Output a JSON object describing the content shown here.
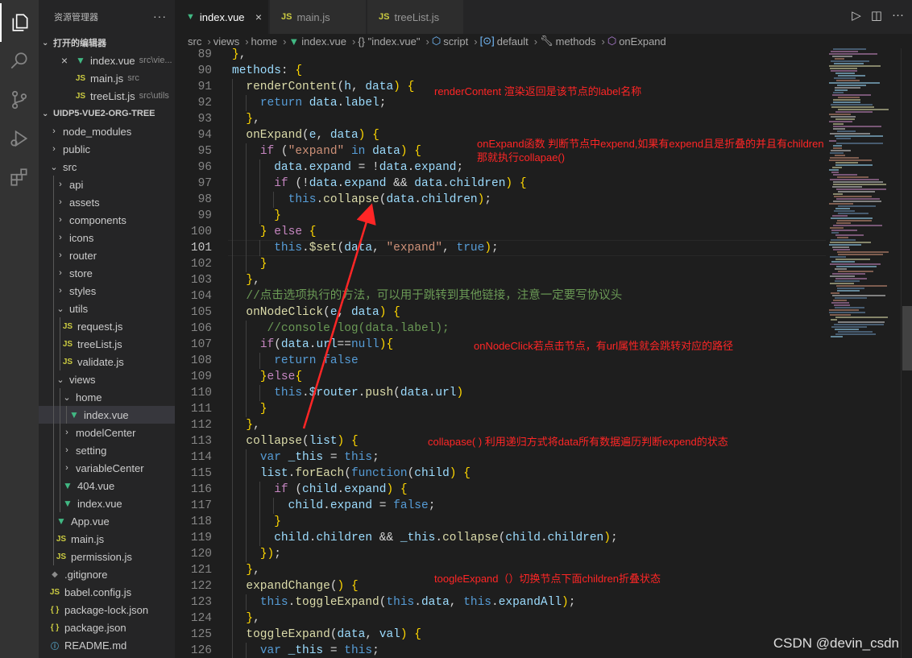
{
  "sidebar": {
    "title": "资源管理器",
    "more": "···",
    "open_editors_label": "打开的编辑器",
    "open_editors": [
      {
        "name": "index.vue",
        "desc": "src\\vie...",
        "type": "vue",
        "close": "×"
      },
      {
        "name": "main.js",
        "desc": "src",
        "type": "js"
      },
      {
        "name": "treeList.js",
        "desc": "src\\utils",
        "type": "js"
      }
    ],
    "project_label": "UIDP5-VUE2-ORG-TREE",
    "tree": [
      {
        "name": "node_modules",
        "kind": "folder",
        "open": false,
        "depth": 0
      },
      {
        "name": "public",
        "kind": "folder",
        "open": false,
        "depth": 0
      },
      {
        "name": "src",
        "kind": "folder",
        "open": true,
        "depth": 0
      },
      {
        "name": "api",
        "kind": "folder",
        "open": false,
        "depth": 1
      },
      {
        "name": "assets",
        "kind": "folder",
        "open": false,
        "depth": 1
      },
      {
        "name": "components",
        "kind": "folder",
        "open": false,
        "depth": 1
      },
      {
        "name": "icons",
        "kind": "folder",
        "open": false,
        "depth": 1
      },
      {
        "name": "router",
        "kind": "folder",
        "open": false,
        "depth": 1
      },
      {
        "name": "store",
        "kind": "folder",
        "open": false,
        "depth": 1
      },
      {
        "name": "styles",
        "kind": "folder",
        "open": false,
        "depth": 1
      },
      {
        "name": "utils",
        "kind": "folder",
        "open": true,
        "depth": 1
      },
      {
        "name": "request.js",
        "kind": "js",
        "depth": 2
      },
      {
        "name": "treeList.js",
        "kind": "js",
        "depth": 2
      },
      {
        "name": "validate.js",
        "kind": "js",
        "depth": 2
      },
      {
        "name": "views",
        "kind": "folder",
        "open": true,
        "depth": 1
      },
      {
        "name": "home",
        "kind": "folder",
        "open": true,
        "depth": 2
      },
      {
        "name": "index.vue",
        "kind": "vue",
        "depth": 3,
        "selected": true
      },
      {
        "name": "modelCenter",
        "kind": "folder",
        "open": false,
        "depth": 2
      },
      {
        "name": "setting",
        "kind": "folder",
        "open": false,
        "depth": 2
      },
      {
        "name": "variableCenter",
        "kind": "folder",
        "open": false,
        "depth": 2
      },
      {
        "name": "404.vue",
        "kind": "vue",
        "depth": 2
      },
      {
        "name": "index.vue",
        "kind": "vue",
        "depth": 2
      },
      {
        "name": "App.vue",
        "kind": "vue",
        "depth": 1
      },
      {
        "name": "main.js",
        "kind": "js",
        "depth": 1
      },
      {
        "name": "permission.js",
        "kind": "js",
        "depth": 1
      },
      {
        "name": ".gitignore",
        "kind": "git",
        "depth": 0
      },
      {
        "name": "babel.config.js",
        "kind": "js",
        "depth": 0
      },
      {
        "name": "package-lock.json",
        "kind": "json",
        "depth": 0
      },
      {
        "name": "package.json",
        "kind": "json",
        "depth": 0
      },
      {
        "name": "README.md",
        "kind": "md",
        "depth": 0
      }
    ]
  },
  "tabs": [
    {
      "label": "index.vue",
      "type": "vue",
      "active": true,
      "close": "×"
    },
    {
      "label": "main.js",
      "type": "js",
      "active": false
    },
    {
      "label": "treeList.js",
      "type": "js",
      "active": false
    }
  ],
  "breadcrumb": {
    "parts": [
      "src",
      "views",
      "home",
      "index.vue",
      "{} \"index.vue\"",
      "script",
      "default",
      "methods",
      "onExpand"
    ]
  },
  "editor": {
    "current_line": 101,
    "lines": [
      {
        "n": 89,
        "code": "},"
      },
      {
        "n": 90,
        "code": "methods: {"
      },
      {
        "n": 91,
        "code": "  renderContent(h, data) {"
      },
      {
        "n": 92,
        "code": "    return data.label;"
      },
      {
        "n": 93,
        "code": "  },"
      },
      {
        "n": 94,
        "code": "  onExpand(e, data) {"
      },
      {
        "n": 95,
        "code": "    if (\"expand\" in data) {"
      },
      {
        "n": 96,
        "code": "      data.expand = !data.expand;"
      },
      {
        "n": 97,
        "code": "      if (!data.expand && data.children) {"
      },
      {
        "n": 98,
        "code": "        this.collapse(data.children);"
      },
      {
        "n": 99,
        "code": "      }"
      },
      {
        "n": 100,
        "code": "    } else {"
      },
      {
        "n": 101,
        "code": "      this.$set(data, \"expand\", true);"
      },
      {
        "n": 102,
        "code": "    }"
      },
      {
        "n": 103,
        "code": "  },"
      },
      {
        "n": 104,
        "code": "  //点击选项执行的方法，可以用于跳转到其他链接，注意一定要写协议头"
      },
      {
        "n": 105,
        "code": "  onNodeClick(e, data) {"
      },
      {
        "n": 106,
        "code": "     //console.log(data.label);"
      },
      {
        "n": 107,
        "code": "    if(data.url==null){"
      },
      {
        "n": 108,
        "code": "      return false"
      },
      {
        "n": 109,
        "code": "    }else{"
      },
      {
        "n": 110,
        "code": "      this.$router.push(data.url)"
      },
      {
        "n": 111,
        "code": "    }"
      },
      {
        "n": 112,
        "code": "  },"
      },
      {
        "n": 113,
        "code": "  collapse(list) {"
      },
      {
        "n": 114,
        "code": "    var _this = this;"
      },
      {
        "n": 115,
        "code": "    list.forEach(function(child) {"
      },
      {
        "n": 116,
        "code": "      if (child.expand) {"
      },
      {
        "n": 117,
        "code": "        child.expand = false;"
      },
      {
        "n": 118,
        "code": "      }"
      },
      {
        "n": 119,
        "code": "      child.children && _this.collapse(child.children);"
      },
      {
        "n": 120,
        "code": "    });"
      },
      {
        "n": 121,
        "code": "  },"
      },
      {
        "n": 122,
        "code": "  expandChange() {"
      },
      {
        "n": 123,
        "code": "    this.toggleExpand(this.data, this.expandAll);"
      },
      {
        "n": 124,
        "code": "  },"
      },
      {
        "n": 125,
        "code": "  toggleExpand(data, val) {"
      },
      {
        "n": 126,
        "code": "    var _this = this;"
      }
    ]
  },
  "annotations": [
    {
      "text": "renderContent 渲染返回是该节点的label名称"
    },
    {
      "text": "onExpand函数 判断节点中expend,如果有expend且是折叠的并且有children"
    },
    {
      "text": "那就执行collapae()"
    },
    {
      "text": "onNodeClick若点击节点，有url属性就会跳转对应的路径"
    },
    {
      "text": "collapase( ) 利用递归方式将data所有数据遍历判断expend的状态"
    },
    {
      "text": "toogleExpand（）切换节点下面children折叠状态"
    }
  ],
  "watermark": "CSDN @devin_csdn",
  "colors": {
    "annotation": "#ff2626",
    "vue": "#41b883",
    "js": "#cbcb41"
  }
}
